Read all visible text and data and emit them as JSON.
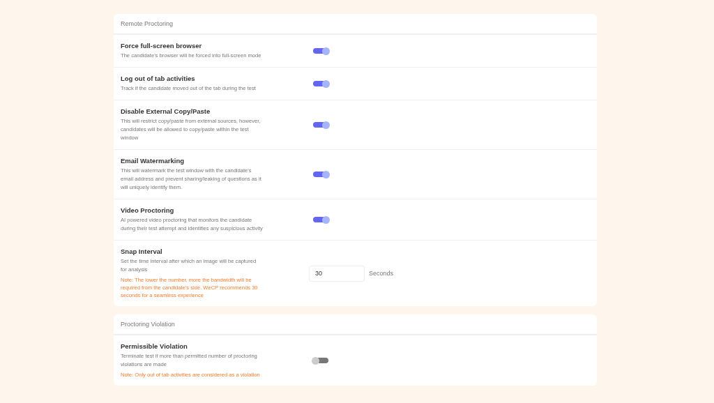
{
  "sections": [
    {
      "title": "Remote Proctoring",
      "rows": [
        {
          "kind": "toggle",
          "label": "Force full-screen browser",
          "description": "The candidate's browser will be forced into full-screen mode",
          "on": true
        },
        {
          "kind": "toggle",
          "label": "Log out of tab activities",
          "description": "Track if the candidate moved out of the tab during the test",
          "on": true
        },
        {
          "kind": "toggle",
          "label": "Disable External Copy/Paste",
          "description": "This will restrict copy/paste from external sources, however, candidates will be allowed to copy/paste within the test window",
          "on": true
        },
        {
          "kind": "toggle",
          "label": "Email Watermarking",
          "description": "This will watermark the test window with the candidate's email address and prevent sharing/leaking of questions as it will uniquely identify them.",
          "on": true
        },
        {
          "kind": "toggle",
          "label": "Video Proctoring",
          "description": "AI powered video proctoring that monitors the candidate during their test attempt and identifies any suspicious activity",
          "on": true
        },
        {
          "kind": "number",
          "label": "Snap Interval",
          "description": "Set the time interval after which an image will be captured for analysis",
          "note": "Note: The lower the number, more the bandwidth will be required from the candidate's side. WeCP recommends 30 seconds for a seamless experience",
          "value": "30",
          "unit": "Seconds"
        }
      ]
    },
    {
      "title": "Proctoring Violation",
      "rows": [
        {
          "kind": "toggle",
          "label": "Permissible Violation",
          "description": "Terminate test if more than permitted number of proctoring violations are made",
          "note": "Note: Only out of tab activities are considered as a violation",
          "on": false
        }
      ]
    }
  ]
}
